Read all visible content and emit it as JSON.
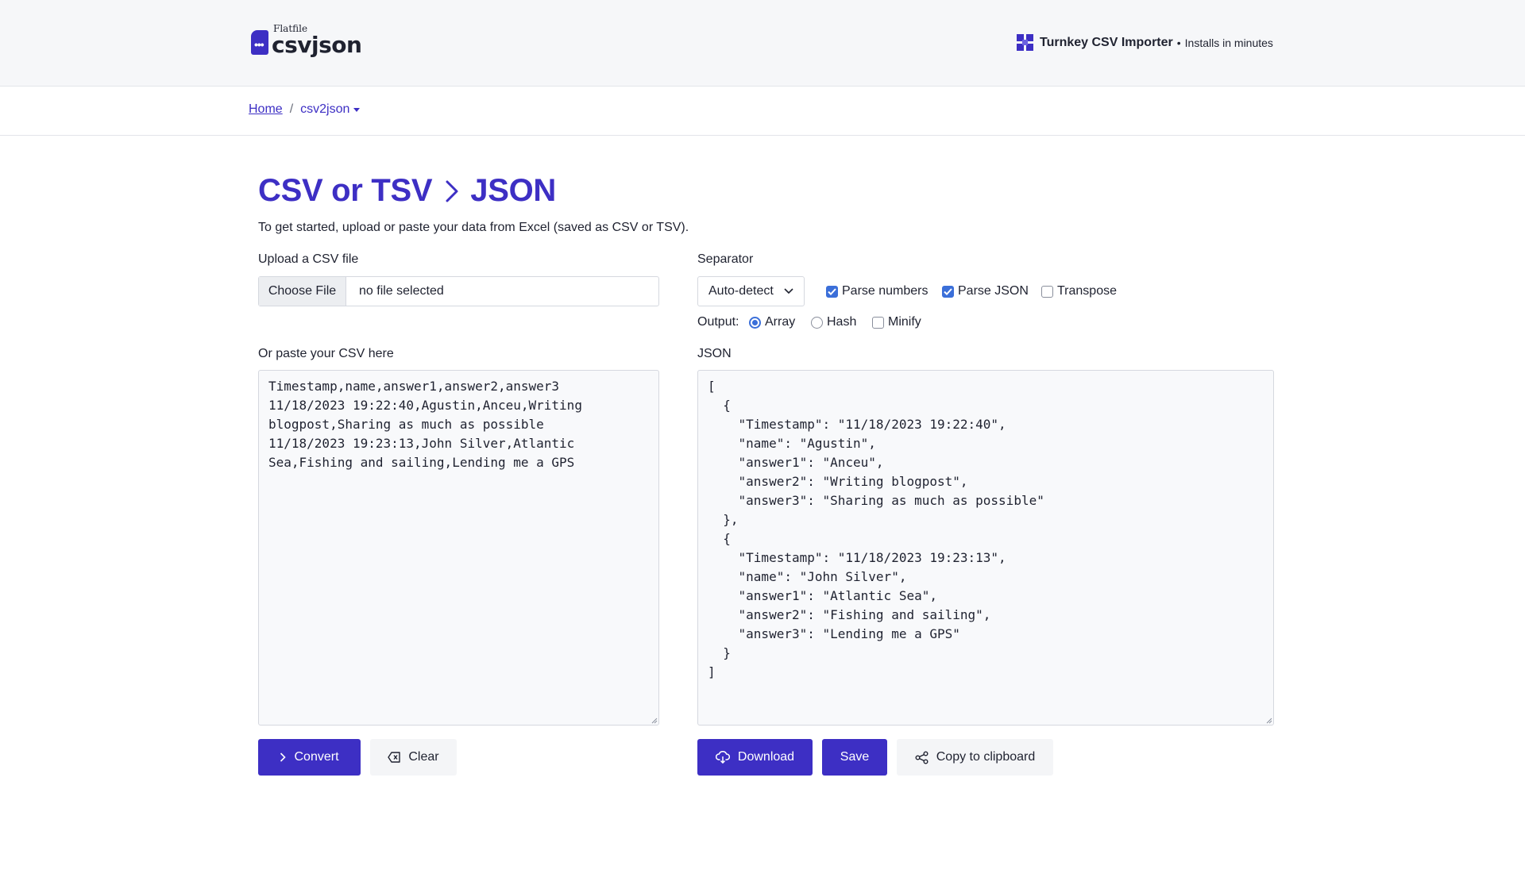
{
  "header": {
    "logo_small": "Flatfile",
    "logo_big": "csvjson",
    "promo_title": "Turnkey CSV Importer",
    "promo_sep": "•",
    "promo_sub": "Installs in minutes"
  },
  "breadcrumb": {
    "home": "Home",
    "sep": "/",
    "current": "csv2json"
  },
  "page": {
    "title_left": "CSV or TSV",
    "title_right": "JSON",
    "intro": "To get started, upload or paste your data from Excel (saved as CSV or TSV)."
  },
  "upload": {
    "label": "Upload a CSV file",
    "button": "Choose File",
    "status": "no file selected"
  },
  "options": {
    "separator_label": "Separator",
    "separator_value": "Auto-detect",
    "parse_numbers": "Parse numbers",
    "parse_json": "Parse JSON",
    "transpose": "Transpose",
    "output_label": "Output:",
    "array": "Array",
    "hash": "Hash",
    "minify": "Minify"
  },
  "csv": {
    "label": "Or paste your CSV here",
    "content": "Timestamp,name,answer1,answer2,answer3\n11/18/2023 19:22:40,Agustin,Anceu,Writing\nblogpost,Sharing as much as possible\n11/18/2023 19:23:13,John Silver,Atlantic\nSea,Fishing and sailing,Lending me a GPS"
  },
  "json": {
    "label": "JSON",
    "content": "[\n  {\n    \"Timestamp\": \"11/18/2023 19:22:40\",\n    \"name\": \"Agustin\",\n    \"answer1\": \"Anceu\",\n    \"answer2\": \"Writing blogpost\",\n    \"answer3\": \"Sharing as much as possible\"\n  },\n  {\n    \"Timestamp\": \"11/18/2023 19:23:13\",\n    \"name\": \"John Silver\",\n    \"answer1\": \"Atlantic Sea\",\n    \"answer2\": \"Fishing and sailing\",\n    \"answer3\": \"Lending me a GPS\"\n  }\n]"
  },
  "actions": {
    "convert": "Convert",
    "clear": "Clear",
    "download": "Download",
    "save": "Save",
    "copy": "Copy to clipboard"
  },
  "colors": {
    "brand": "#3d2fc4",
    "checkbox": "#3b6fd9"
  }
}
